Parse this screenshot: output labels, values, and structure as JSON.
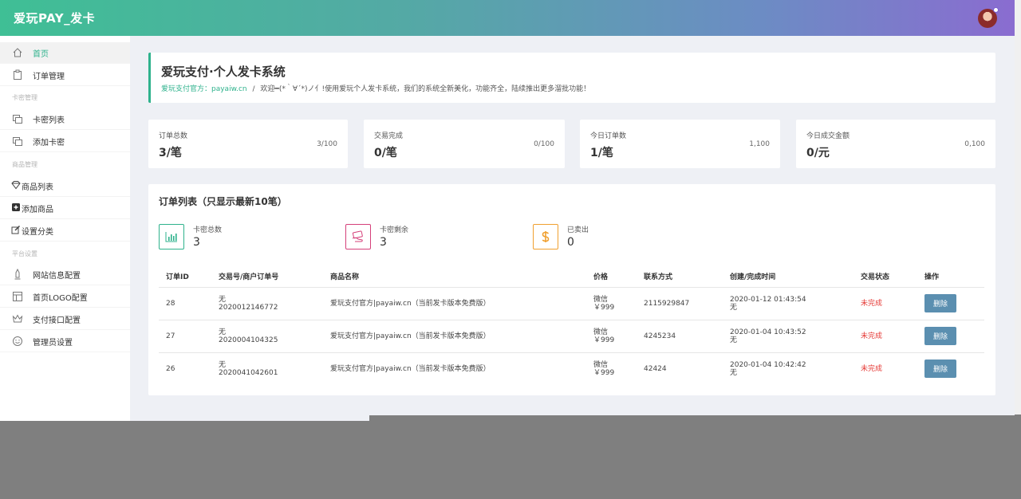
{
  "header": {
    "brand": "爱玩PAY_发卡"
  },
  "sidebar": {
    "items": [
      {
        "label": "首页",
        "icon": "home-icon"
      },
      {
        "label": "订单管理",
        "icon": "clipboard-icon"
      },
      {
        "label": "卡密列表",
        "icon": "copy-icon"
      },
      {
        "label": "添加卡密",
        "icon": "copy-icon"
      },
      {
        "label": "商品列表",
        "icon": "diamond-icon"
      },
      {
        "label": "添加商品",
        "icon": "plus-square-icon"
      },
      {
        "label": "设置分类",
        "icon": "edit-icon"
      },
      {
        "label": "网站信息配置",
        "icon": "tower-icon"
      },
      {
        "label": "首页LOGO配置",
        "icon": "layout-icon"
      },
      {
        "label": "支付接口配置",
        "icon": "crown-icon"
      },
      {
        "label": "管理员设置",
        "icon": "smile-icon"
      }
    ],
    "sections": [
      "卡密管理",
      "商品管理",
      "平台设置"
    ]
  },
  "welcome": {
    "title": "爱玩支付·个人发卡系统",
    "link": "爱玩支付官方：payaiw.cn",
    "separator": "/",
    "message": "欢迎━(*｀∀´*)ノ亻!使用爱玩个人发卡系统，我们的系统全新美化，功能齐全，陆续推出更多溜批功能！"
  },
  "stats": [
    {
      "label": "订单总数",
      "value": "3/笔",
      "ratio": "3/100"
    },
    {
      "label": "交易完成",
      "value": "0/笔",
      "ratio": "0/100"
    },
    {
      "label": "今日订单数",
      "value": "1/笔",
      "ratio": "1,100"
    },
    {
      "label": "今日成交金额",
      "value": "0/元",
      "ratio": "0,100"
    }
  ],
  "orders": {
    "title": "订单列表（只显示最新10笔）",
    "summary": [
      {
        "label": "卡密总数",
        "value": "3",
        "icon": "bar-chart-icon",
        "color": "#2eb28c"
      },
      {
        "label": "卡密剩余",
        "value": "3",
        "icon": "hand-card-icon",
        "color": "#d5407a"
      },
      {
        "label": "已卖出",
        "value": "0",
        "icon": "dollar-icon",
        "color": "#f0a030"
      }
    ],
    "columns": [
      "订单ID",
      "交易号/商户订单号",
      "商品名称",
      "价格",
      "联系方式",
      "创建/完成时间",
      "交易状态",
      "操作"
    ],
    "rows": [
      {
        "id": "28",
        "trade_no": "无",
        "merchant_no": "2020012146772",
        "product": "爱玩支付官方|payaiw.cn（当前发卡版本免费版）",
        "pay": "微信",
        "price": "￥999",
        "contact": "2115929847",
        "created": "2020-01-12 01:43:54",
        "finished": "无",
        "status": "未完成",
        "action": "删除"
      },
      {
        "id": "27",
        "trade_no": "无",
        "merchant_no": "2020004104325",
        "product": "爱玩支付官方|payaiw.cn（当前发卡版本免费版）",
        "pay": "微信",
        "price": "￥999",
        "contact": "4245234",
        "created": "2020-01-04 10:43:52",
        "finished": "无",
        "status": "未完成",
        "action": "删除"
      },
      {
        "id": "26",
        "trade_no": "无",
        "merchant_no": "2020041042601",
        "product": "爱玩支付官方|payaiw.cn（当前发卡版本免费版）",
        "pay": "微信",
        "price": "￥999",
        "contact": "42424",
        "created": "2020-01-04 10:42:42",
        "finished": "无",
        "status": "未完成",
        "action": "删除"
      }
    ]
  },
  "colors": {
    "accent": "#2eb28c",
    "danger": "#e53935",
    "button": "#5b8fb0"
  }
}
